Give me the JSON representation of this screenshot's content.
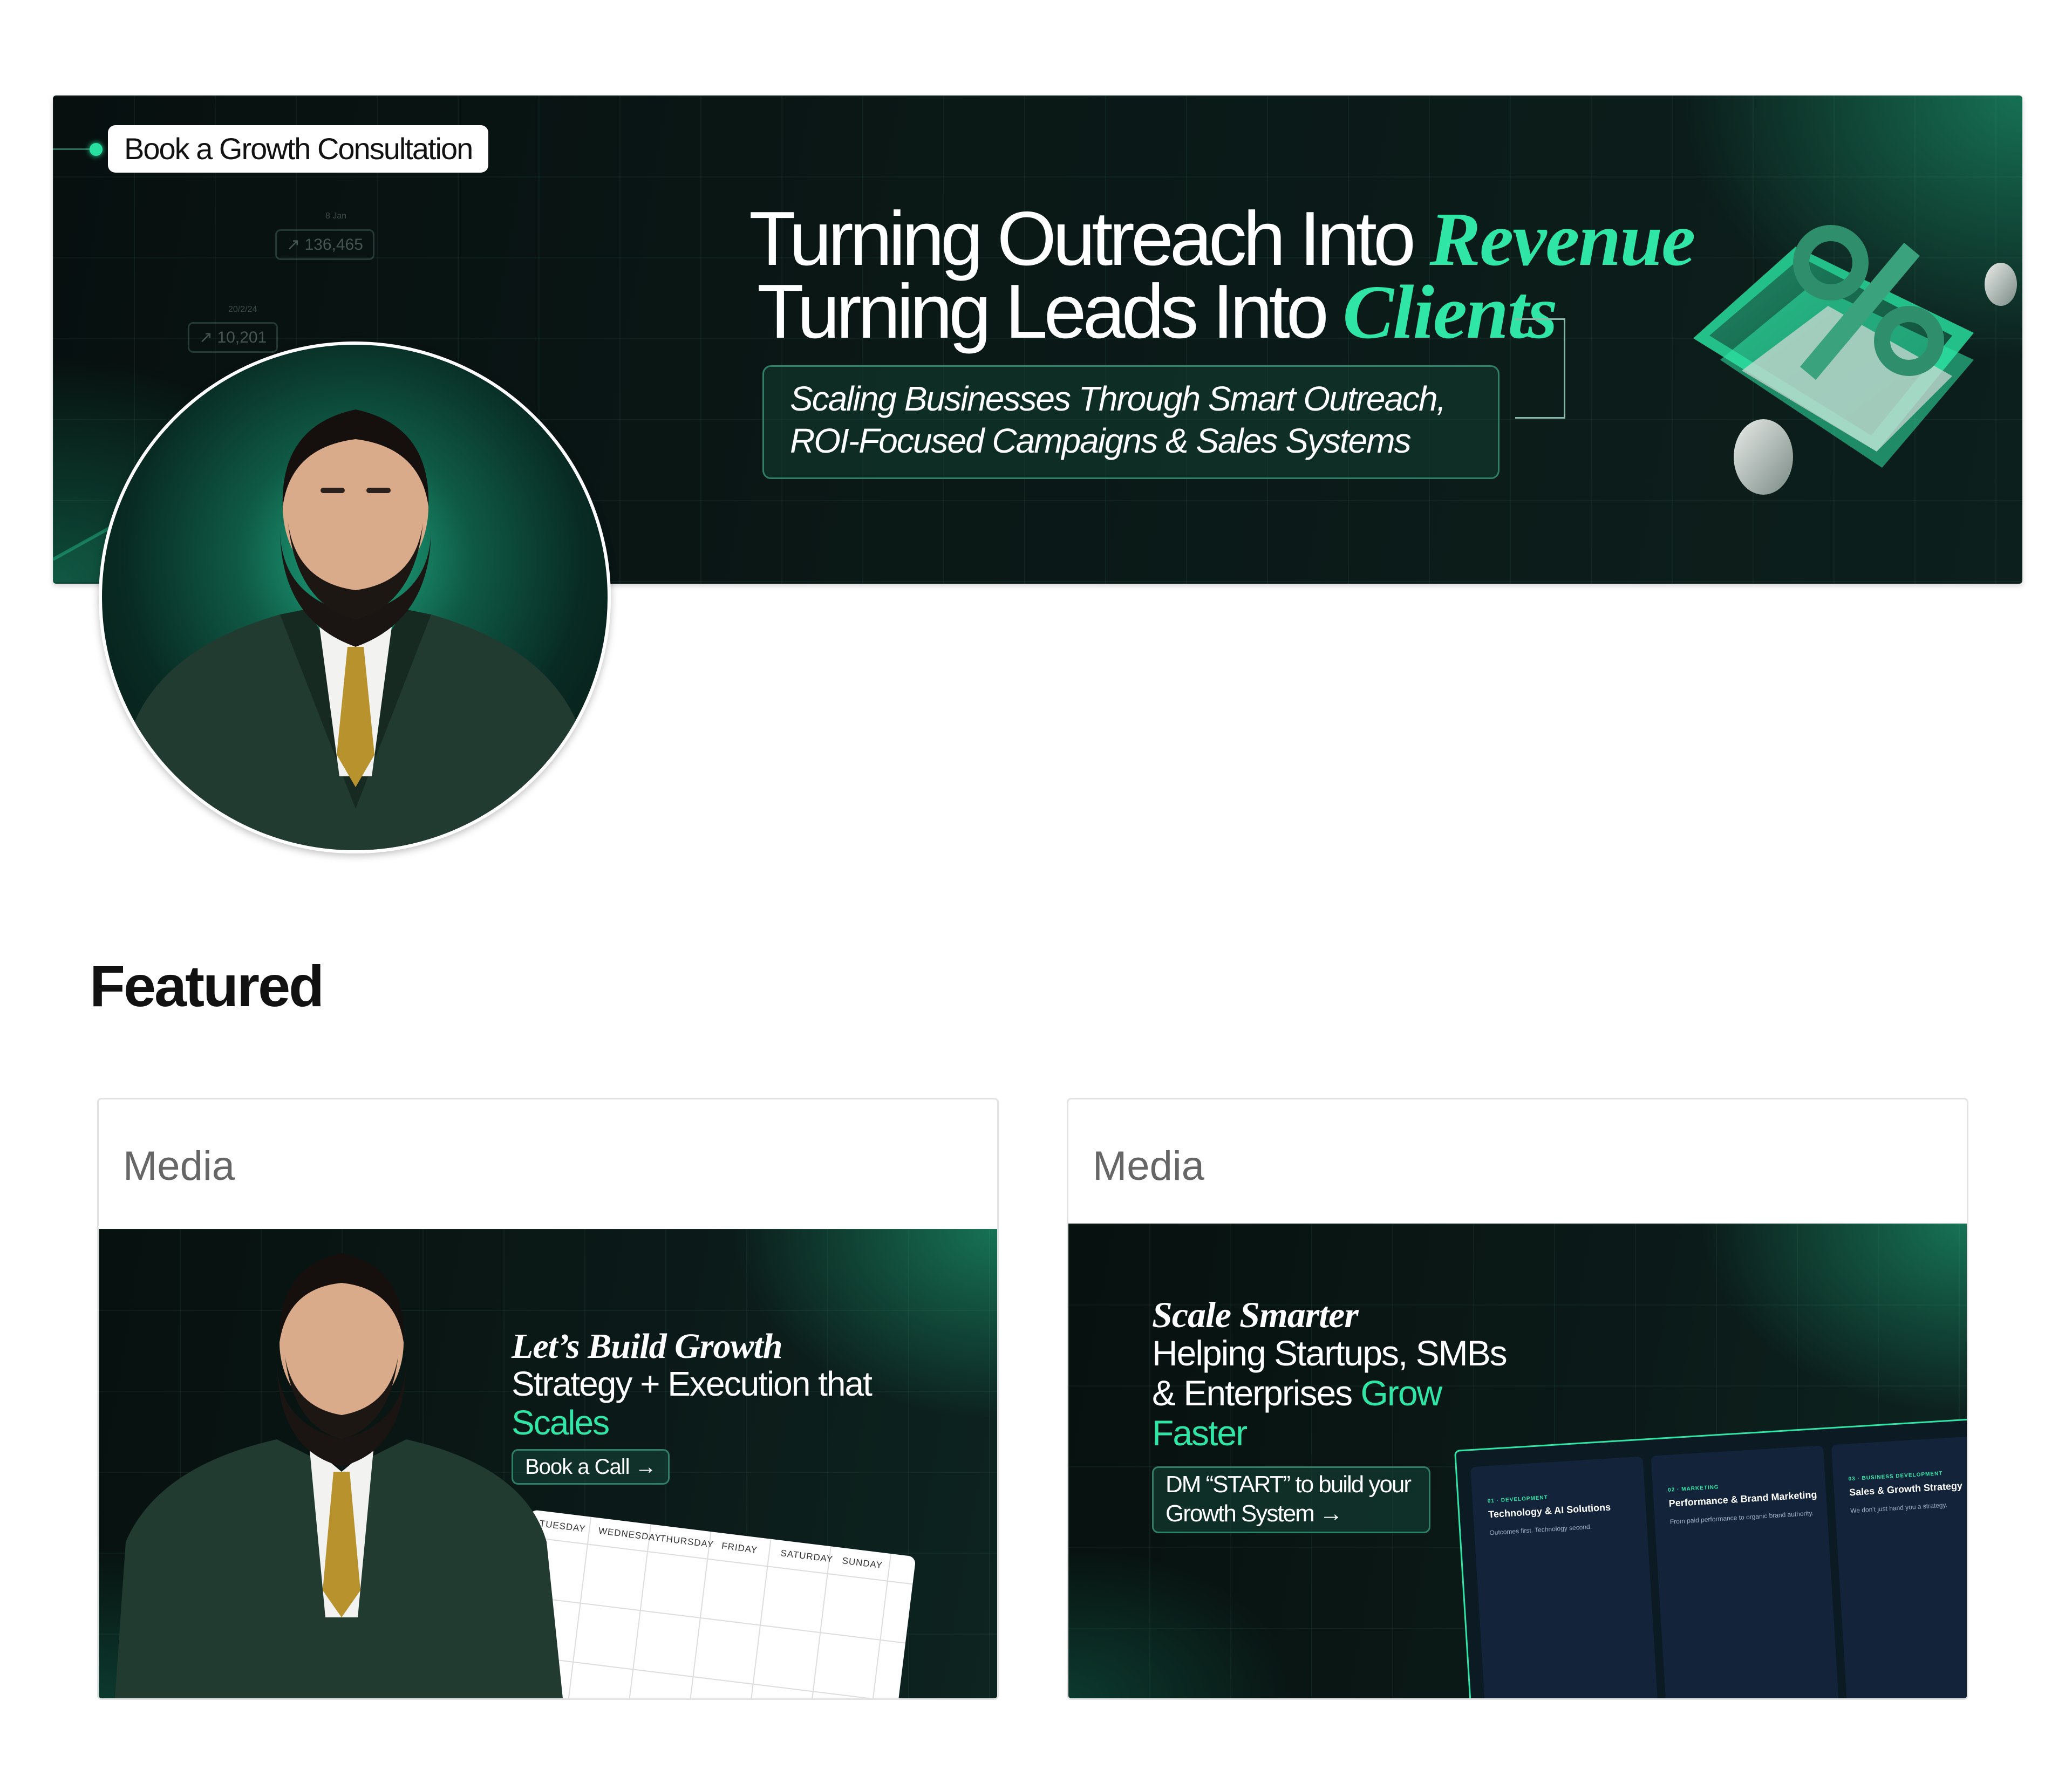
{
  "banner": {
    "consult_label": "Book a Growth Consultation",
    "stats": [
      {
        "caption": "8 Jan",
        "value": "136,465"
      },
      {
        "caption": "20/2/24",
        "value": "10,201"
      }
    ],
    "headline_1": "Turning Outreach Into",
    "headline_1_accent": "Revenue",
    "headline_2": "Turning Leads Into",
    "headline_2_accent": "Clients",
    "subtitle_1": "Scaling Businesses Through Smart Outreach,",
    "subtitle_2": "ROI-Focused Campaigns & Sales Systems"
  },
  "featured": {
    "title": "Featured",
    "cards": [
      {
        "label": "Media",
        "title_serif": "Let’s Build Growth",
        "line_2": "Strategy + Execution that",
        "line_3_accent": "Scales",
        "cta": "Book a Call",
        "calendar_days": [
          "TUESDAY",
          "WEDNESDAY",
          "THURSDAY",
          "FRIDAY",
          "SATURDAY",
          "SUNDAY"
        ]
      },
      {
        "label": "Media",
        "title_serif": "Scale Smarter",
        "line_2": "Helping Startups, SMBs",
        "line_3": "& Enterprises",
        "line_3_accent": "Grow",
        "line_4_accent": "Faster",
        "cta_1": "DM “START” to build your",
        "cta_2": "Growth System",
        "services": [
          {
            "tag": "01 · DEVELOPMENT",
            "title": "Technology & AI Solutions",
            "body": "Outcomes first. Technology second."
          },
          {
            "tag": "02 · MARKETING",
            "title": "Performance & Brand Marketing",
            "body": "From paid performance to organic brand authority."
          },
          {
            "tag": "03 · BUSINESS DEVELOPMENT",
            "title": "Sales & Growth Strategy",
            "body": "We don't just hand you a strategy."
          }
        ]
      }
    ]
  },
  "colors": {
    "accent": "#2fe6a6",
    "banner_bg": "#0a1816"
  }
}
